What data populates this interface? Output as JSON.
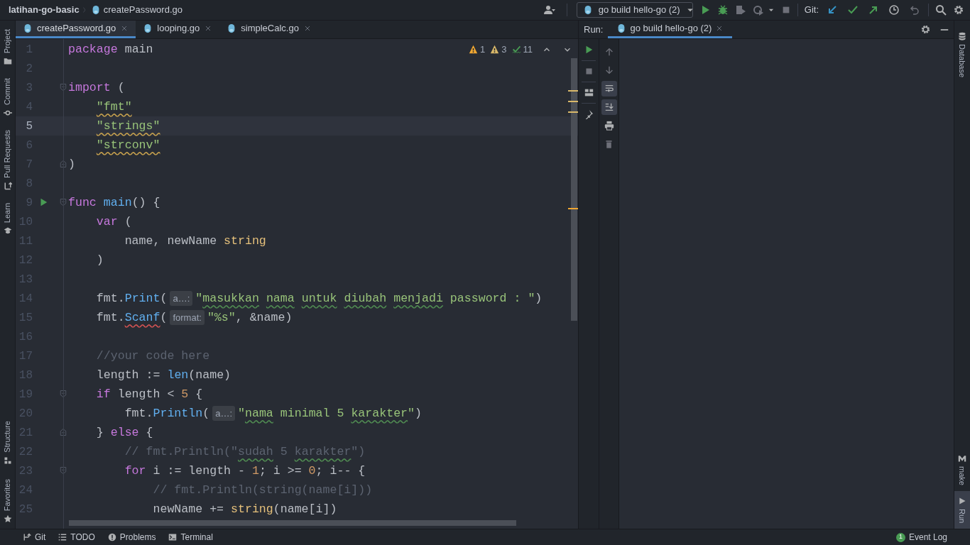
{
  "breadcrumb": [
    "latihan-go-basic",
    "createPassword.go"
  ],
  "run_config": {
    "label": "go build hello-go (2)"
  },
  "git_label": "Git:",
  "left_tools_top": [
    {
      "label": "Project",
      "kind": "project"
    },
    {
      "label": "Commit",
      "kind": "commit"
    },
    {
      "label": "Pull Requests",
      "kind": "pull"
    },
    {
      "label": "Learn",
      "kind": "learn"
    }
  ],
  "left_tools_bottom": [
    {
      "label": "Structure",
      "kind": "structure"
    },
    {
      "label": "Favorites",
      "kind": "favorites"
    }
  ],
  "editor_tabs": [
    {
      "label": "createPassword.go",
      "selected": true
    },
    {
      "label": "looping.go",
      "selected": false
    },
    {
      "label": "simpleCalc.go",
      "selected": false
    }
  ],
  "inspections": [
    {
      "kind": "error",
      "count": "1"
    },
    {
      "kind": "warning",
      "count": "3"
    },
    {
      "kind": "typo",
      "count": "11"
    }
  ],
  "code_lines": [
    {
      "number": "1",
      "tokens": [
        {
          "text": "package",
          "kind": "keyword"
        },
        {
          "text": " main",
          "kind": "plain"
        }
      ]
    },
    {
      "number": "2"
    },
    {
      "number": "3",
      "fold_start": true,
      "tokens": [
        {
          "text": "import",
          "kind": "keyword"
        },
        {
          "text": " (",
          "kind": "plain"
        }
      ]
    },
    {
      "number": "4",
      "tokens": [
        {
          "text": "    \"fmt\"",
          "kind": "string",
          "warning": true
        }
      ]
    },
    {
      "number": "5",
      "current": true,
      "tokens": [
        {
          "text": "    \"strings\"",
          "kind": "string",
          "warning": true
        }
      ]
    },
    {
      "number": "6",
      "tokens": [
        {
          "text": "    \"strconv\"",
          "kind": "string",
          "warning": true
        }
      ]
    },
    {
      "number": "7",
      "fold_end": true,
      "tokens": [
        {
          "text": ")",
          "kind": "plain"
        }
      ]
    },
    {
      "number": "8"
    },
    {
      "number": "9",
      "fold_start": true,
      "run": true,
      "tokens": [
        {
          "text": "func",
          "kind": "keyword"
        },
        {
          "text": " main",
          "kind": "function"
        },
        {
          "text": "() {",
          "kind": "plain"
        }
      ]
    },
    {
      "number": "10",
      "tokens": [
        {
          "text": "    var",
          "kind": "keyword"
        },
        {
          "text": " (",
          "kind": "plain"
        }
      ]
    },
    {
      "number": "11",
      "tokens": [
        {
          "text": "        name, newName ",
          "kind": "plain"
        },
        {
          "text": "string",
          "kind": "type"
        }
      ]
    },
    {
      "number": "12",
      "tokens": [
        {
          "text": "    )",
          "kind": "plain"
        }
      ]
    },
    {
      "number": "13"
    },
    {
      "number": "14",
      "tokens": [
        {
          "text": "    fmt.",
          "kind": "plain"
        },
        {
          "text": "Print",
          "kind": "function"
        },
        {
          "text": "(",
          "kind": "plain"
        },
        {
          "text": "a…:",
          "kind": "hint"
        },
        {
          "text": "\"",
          "kind": "string"
        },
        {
          "text": "masukkan",
          "kind": "string",
          "typo": true
        },
        {
          "text": " nama",
          "kind": "string",
          "typo": true
        },
        {
          "text": " untuk",
          "kind": "string",
          "typo": true
        },
        {
          "text": " diubah",
          "kind": "string",
          "typo": true
        },
        {
          "text": " menjadi",
          "kind": "string",
          "typo": true
        },
        {
          "text": " password : \"",
          "kind": "string"
        },
        {
          "text": ")",
          "kind": "plain"
        }
      ]
    },
    {
      "number": "15",
      "tokens": [
        {
          "text": "    fmt.",
          "kind": "plain"
        },
        {
          "text": "Scanf",
          "kind": "function",
          "error": true
        },
        {
          "text": "(",
          "kind": "plain"
        },
        {
          "text": "format:",
          "kind": "hint"
        },
        {
          "text": "\"%s\"",
          "kind": "string"
        },
        {
          "text": ", &name)",
          "kind": "plain"
        }
      ]
    },
    {
      "number": "16"
    },
    {
      "number": "17",
      "tokens": [
        {
          "text": "    //your code here",
          "kind": "comment"
        }
      ]
    },
    {
      "number": "18",
      "tokens": [
        {
          "text": "    length := ",
          "kind": "plain"
        },
        {
          "text": "len",
          "kind": "function"
        },
        {
          "text": "(name)",
          "kind": "plain"
        }
      ]
    },
    {
      "number": "19",
      "fold_start": true,
      "tokens": [
        {
          "text": "    if",
          "kind": "keyword"
        },
        {
          "text": " length < ",
          "kind": "plain"
        },
        {
          "text": "5",
          "kind": "number"
        },
        {
          "text": " {",
          "kind": "plain"
        }
      ]
    },
    {
      "number": "20",
      "tokens": [
        {
          "text": "        fmt.",
          "kind": "plain"
        },
        {
          "text": "Println",
          "kind": "function"
        },
        {
          "text": "(",
          "kind": "plain"
        },
        {
          "text": "a…:",
          "kind": "hint"
        },
        {
          "text": "\"",
          "kind": "string"
        },
        {
          "text": "nama",
          "kind": "string",
          "typo": true
        },
        {
          "text": " minimal 5 ",
          "kind": "string"
        },
        {
          "text": "karakter",
          "kind": "string",
          "typo": true
        },
        {
          "text": "\"",
          "kind": "string"
        },
        {
          "text": ")",
          "kind": "plain"
        }
      ]
    },
    {
      "number": "21",
      "fold_end": true,
      "tokens": [
        {
          "text": "    } ",
          "kind": "plain"
        },
        {
          "text": "else",
          "kind": "keyword"
        },
        {
          "text": " {",
          "kind": "plain"
        }
      ]
    },
    {
      "number": "22",
      "tokens": [
        {
          "text": "        // fmt.Println(\"",
          "kind": "comment"
        },
        {
          "text": "sudah",
          "kind": "comment",
          "typo": true
        },
        {
          "text": " 5 ",
          "kind": "comment"
        },
        {
          "text": "karakter",
          "kind": "comment",
          "typo": true
        },
        {
          "text": "\")",
          "kind": "comment"
        }
      ]
    },
    {
      "number": "23",
      "fold_start": true,
      "tokens": [
        {
          "text": "        for",
          "kind": "keyword"
        },
        {
          "text": " i := length - ",
          "kind": "plain"
        },
        {
          "text": "1",
          "kind": "number"
        },
        {
          "text": "; i >= ",
          "kind": "plain"
        },
        {
          "text": "0",
          "kind": "number"
        },
        {
          "text": "; i-- {",
          "kind": "plain"
        }
      ]
    },
    {
      "number": "24",
      "tokens": [
        {
          "text": "            // fmt.Println(string(name[i]))",
          "kind": "comment"
        }
      ]
    },
    {
      "number": "25",
      "tokens": [
        {
          "text": "            newName += ",
          "kind": "plain"
        },
        {
          "text": "string",
          "kind": "type"
        },
        {
          "text": "(name[i])",
          "kind": "plain"
        }
      ]
    }
  ],
  "run_panel": {
    "label": "Run:",
    "tabs": [
      {
        "label": "go build hello-go (2)",
        "selected": true
      }
    ],
    "soft_wrap": true,
    "scroll_to_end": true
  },
  "right_tools": [
    {
      "label": "Database",
      "kind": "database",
      "selected": false
    },
    {
      "label": "make",
      "kind": "make",
      "selected": false
    },
    {
      "label": "Run",
      "kind": "run",
      "selected": true
    }
  ],
  "bottom_tools": [
    {
      "label": "Git",
      "kind": "git"
    },
    {
      "label": "TODO",
      "kind": "todo"
    },
    {
      "label": "Problems",
      "kind": "problems"
    },
    {
      "label": "Terminal",
      "kind": "terminal"
    }
  ],
  "event_log": {
    "label": "Event Log",
    "badge": "1"
  }
}
